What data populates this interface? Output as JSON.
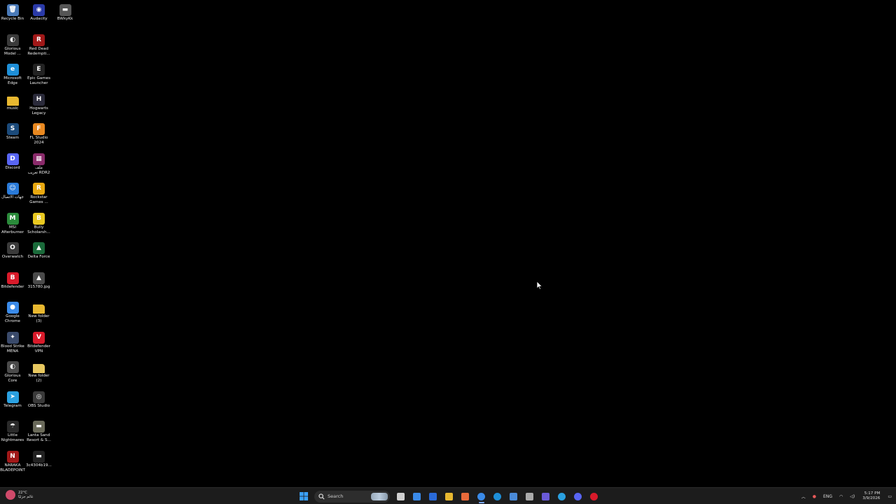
{
  "desktop_icons": [
    {
      "label": "Recycle Bin",
      "icon": "recycle-bin-icon",
      "color": "#4a7ab8",
      "glyph": "🗑"
    },
    {
      "label": "Audacity",
      "icon": "audacity-icon",
      "color": "#2a3aa8",
      "glyph": "◉"
    },
    {
      "label": "BWkyKk",
      "icon": "image-file-icon",
      "color": "#555555",
      "glyph": "▬"
    },
    {
      "label": "Glorious\nModel ...",
      "icon": "glorious-mouse-icon",
      "color": "#3a3a3a",
      "glyph": "◐"
    },
    {
      "label": "Red Dead\nRedempti...",
      "icon": "red-dead-redemption-icon",
      "color": "#a01818",
      "glyph": "R"
    },
    {
      "label": "Microsoft\nEdge",
      "icon": "edge-icon",
      "color": "#1e8fd8",
      "glyph": "e"
    },
    {
      "label": "Epic Games\nLauncher",
      "icon": "epic-games-icon",
      "color": "#222222",
      "glyph": "E"
    },
    {
      "label": "music",
      "icon": "folder-icon",
      "color": "#e8b830",
      "glyph": ""
    },
    {
      "label": "Hogwarts\nLegacy",
      "icon": "hogwarts-legacy-icon",
      "color": "#2a2a3a",
      "glyph": "H"
    },
    {
      "label": "Steam",
      "icon": "steam-icon",
      "color": "#1b4a7a",
      "glyph": "S"
    },
    {
      "label": "FL Studio\n2024",
      "icon": "fl-studio-icon",
      "color": "#e88820",
      "glyph": "F"
    },
    {
      "label": "Discord",
      "icon": "discord-icon",
      "color": "#5865f2",
      "glyph": "D"
    },
    {
      "label": "ملف\nتعريب RDR2",
      "icon": "winrar-archive-icon",
      "color": "#8a2a6a",
      "glyph": "▦"
    },
    {
      "label": "جهات الاتصال",
      "icon": "contacts-icon",
      "color": "#2a7ad8",
      "glyph": "☺"
    },
    {
      "label": "Rockstar\nGames ...",
      "icon": "rockstar-games-icon",
      "color": "#e8a810",
      "glyph": "R"
    },
    {
      "label": "MSI\nAfterburner",
      "icon": "msi-afterburner-icon",
      "color": "#2a8a3a",
      "glyph": "M"
    },
    {
      "label": "Bully\nScholarsh...",
      "icon": "bully-icon",
      "color": "#e8c820",
      "glyph": "B"
    },
    {
      "label": "Overwatch",
      "icon": "overwatch-icon",
      "color": "#3a3a3a",
      "glyph": "O"
    },
    {
      "label": "Delta Force",
      "icon": "delta-force-icon",
      "color": "#1a6a3a",
      "glyph": "▲"
    },
    {
      "label": "Bitdefender",
      "icon": "bitdefender-icon",
      "color": "#d81a2a",
      "glyph": "B"
    },
    {
      "label": "315780.jpg",
      "icon": "jpg-image-icon",
      "color": "#4a4a4a",
      "glyph": "▲"
    },
    {
      "label": "Google\nChrome",
      "icon": "chrome-icon",
      "color": "#3a8ae8",
      "glyph": "●"
    },
    {
      "label": "New folder\n(3)",
      "icon": "folder-icon",
      "color": "#e8b830",
      "glyph": ""
    },
    {
      "label": "Blood Strike\nMENA",
      "icon": "blood-strike-icon",
      "color": "#3a4a6a",
      "glyph": "✦"
    },
    {
      "label": "Bitdefender\nVPN",
      "icon": "bitdefender-vpn-icon",
      "color": "#d81a2a",
      "glyph": "V"
    },
    {
      "label": "Glorious\nCore",
      "icon": "glorious-core-icon",
      "color": "#4a4a4a",
      "glyph": "◐"
    },
    {
      "label": "New folder\n(2)",
      "icon": "folder-icon",
      "color": "#e8c860",
      "glyph": ""
    },
    {
      "label": "Telegram",
      "icon": "telegram-icon",
      "color": "#2aa0e0",
      "glyph": "➤"
    },
    {
      "label": "OBS Studio",
      "icon": "obs-studio-icon",
      "color": "#3a3a3a",
      "glyph": "◎"
    },
    {
      "label": "Little\nNightmares",
      "icon": "little-nightmares-icon",
      "color": "#2a2a2a",
      "glyph": "☂"
    },
    {
      "label": "Lanta Sand\nResort & S...",
      "icon": "image-file-icon",
      "color": "#6a6a5a",
      "glyph": "▬"
    },
    {
      "label": "NARAKA\nBLADEPOINT",
      "icon": "naraka-icon",
      "color": "#a01818",
      "glyph": "N"
    },
    {
      "label": "3c4304b19...",
      "icon": "image-file-icon",
      "color": "#222222",
      "glyph": "▬"
    }
  ],
  "taskbar": {
    "weather": {
      "temp": "22°C",
      "condition": "غائم جزئيًا"
    },
    "search_label": "Search",
    "apps": [
      {
        "name": "task-view-icon",
        "color": "#cfcfcf"
      },
      {
        "name": "calendar-app-icon",
        "color": "#3a8ae8"
      },
      {
        "name": "mail-app-icon",
        "color": "#2a6ad8"
      },
      {
        "name": "file-explorer-icon",
        "color": "#e8b830"
      },
      {
        "name": "copilot-icon",
        "color": "#e86a3a"
      },
      {
        "name": "chrome-icon",
        "color": "#3a8ae8",
        "active": true
      },
      {
        "name": "edge-icon",
        "color": "#1e8fd8"
      },
      {
        "name": "control-panel-icon",
        "color": "#4a8ad8"
      },
      {
        "name": "settings-icon",
        "color": "#aaaaaa"
      },
      {
        "name": "teams-icon",
        "color": "#6a5ad8"
      },
      {
        "name": "telegram-icon",
        "color": "#2aa0e0"
      },
      {
        "name": "discord-icon",
        "color": "#5865f2"
      },
      {
        "name": "bitdefender-icon",
        "color": "#d81a2a"
      }
    ],
    "tray": {
      "lang": "ENG",
      "time": "5:17 PM",
      "date": "3/9/2026"
    }
  }
}
